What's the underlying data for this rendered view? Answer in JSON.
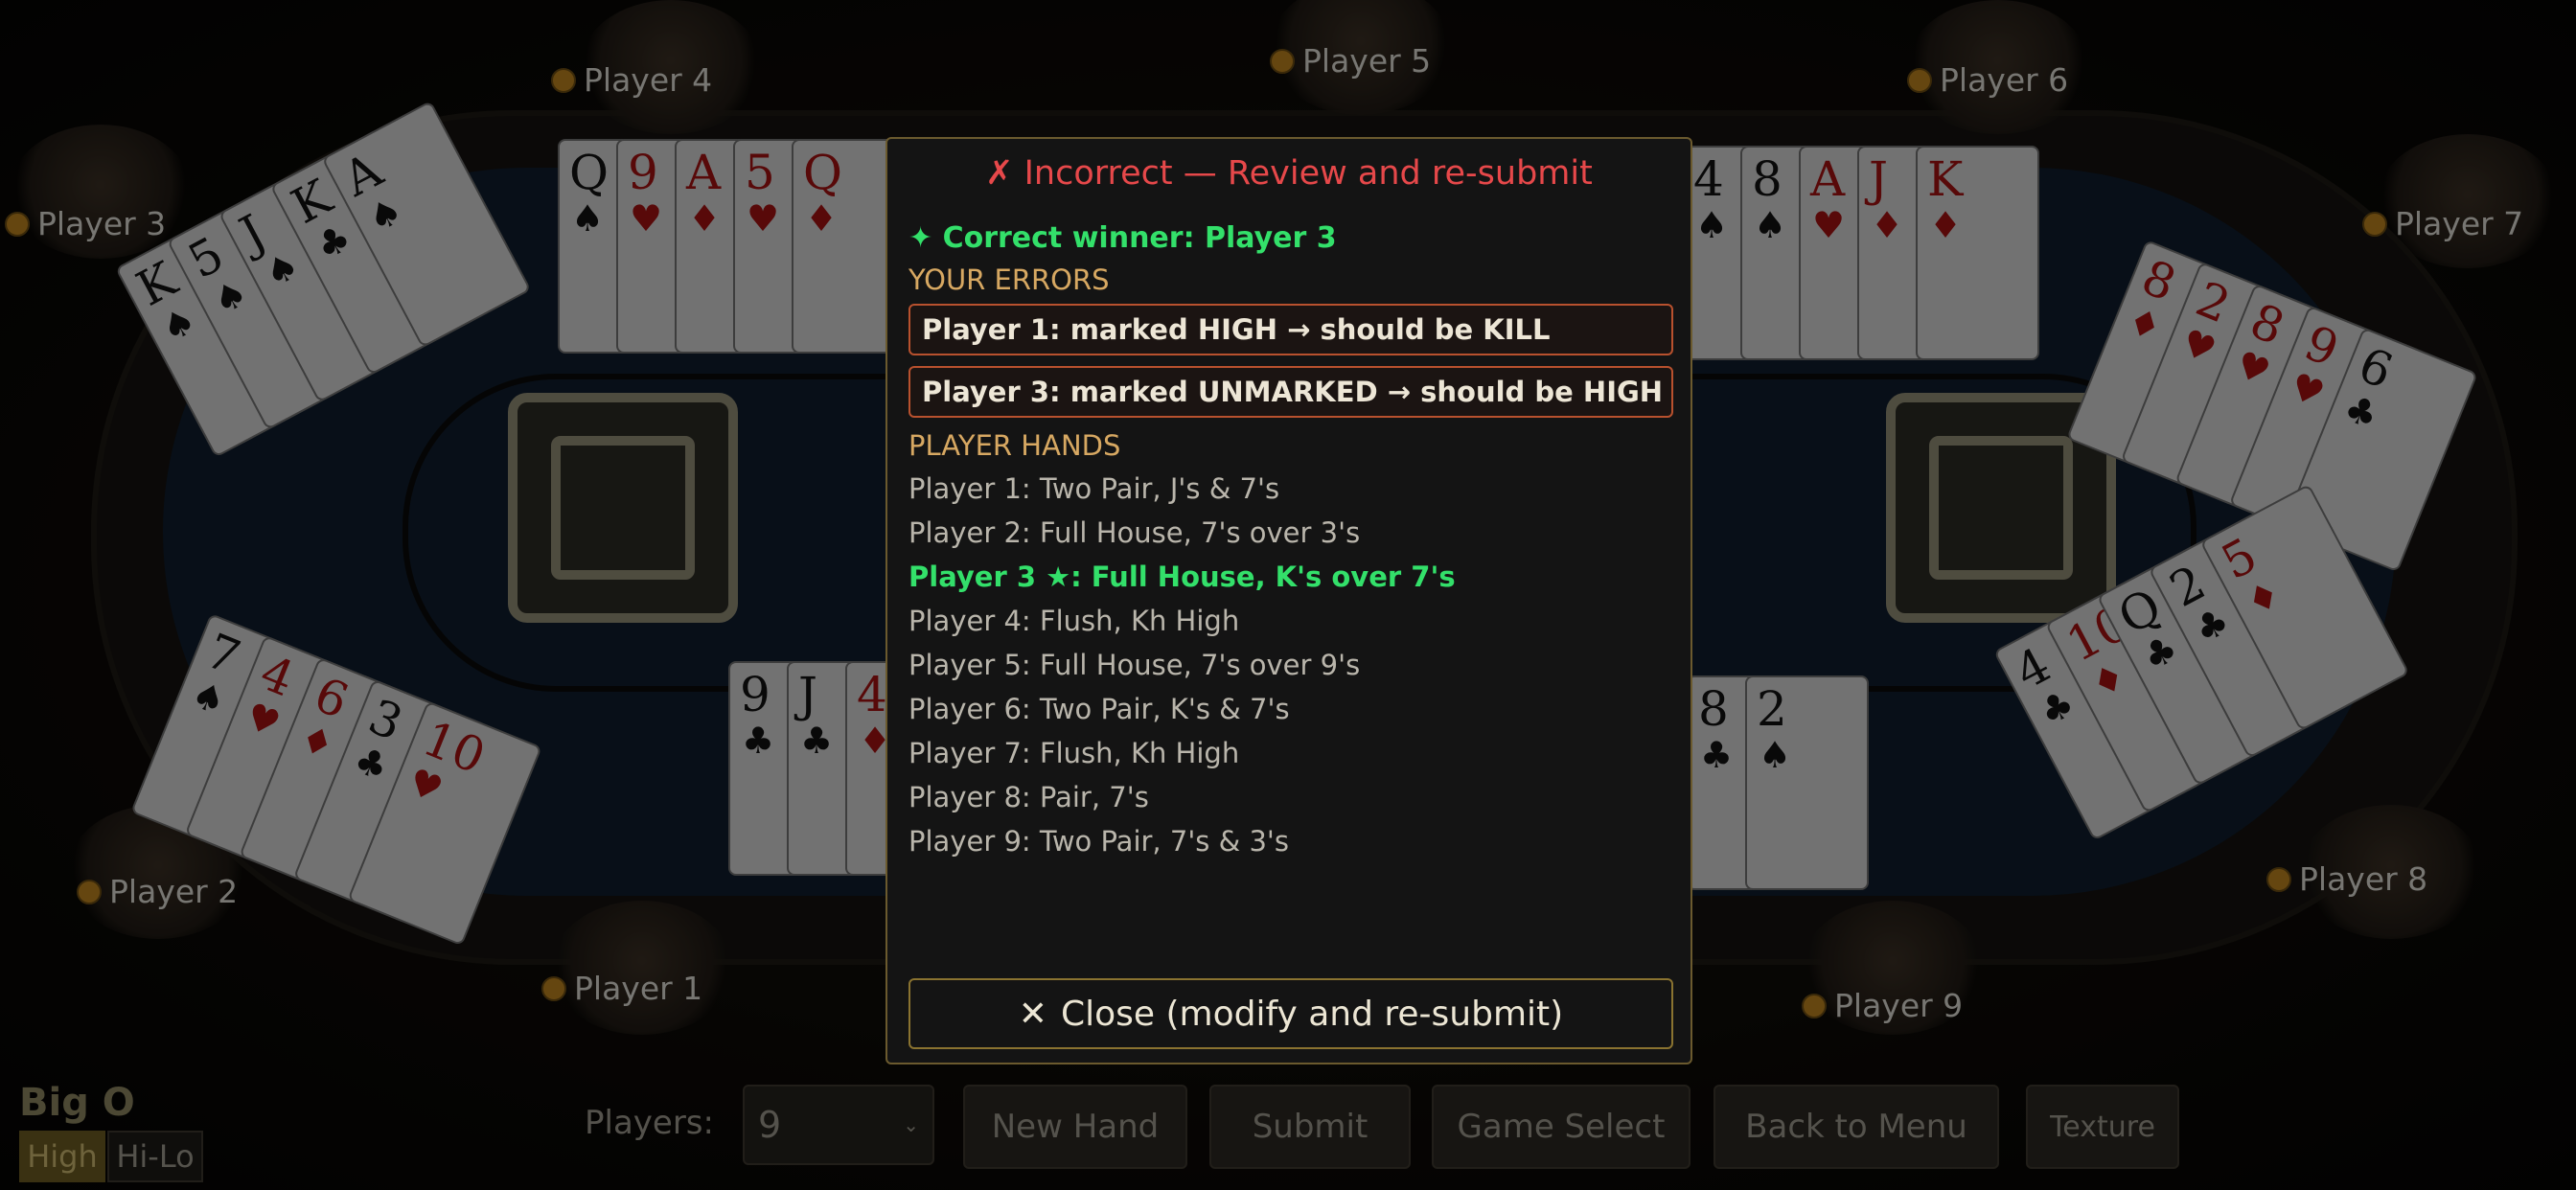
{
  "seats": [
    {
      "name": "Player 1"
    },
    {
      "name": "Player 2"
    },
    {
      "name": "Player 3"
    },
    {
      "name": "Player 4"
    },
    {
      "name": "Player 5"
    },
    {
      "name": "Player 6"
    },
    {
      "name": "Player 7"
    },
    {
      "name": "Player 8"
    },
    {
      "name": "Player 9"
    }
  ],
  "table_cards": {
    "p4": [
      {
        "rank": "Q",
        "suit": "♠",
        "color": "black"
      },
      {
        "rank": "9",
        "suit": "♥",
        "color": "red"
      },
      {
        "rank": "A",
        "suit": "♦",
        "color": "red"
      },
      {
        "rank": "5",
        "suit": "♥",
        "color": "red"
      },
      {
        "rank": "Q",
        "suit": "♦",
        "color": "red"
      }
    ],
    "p6": [
      {
        "rank": "4",
        "suit": "♠",
        "color": "black"
      },
      {
        "rank": "8",
        "suit": "♠",
        "color": "black"
      },
      {
        "rank": "A",
        "suit": "♥",
        "color": "red"
      },
      {
        "rank": "J",
        "suit": "♦",
        "color": "red"
      },
      {
        "rank": "K",
        "suit": "♦",
        "color": "red"
      }
    ],
    "p3": [
      {
        "rank": "K",
        "suit": "♠",
        "color": "black"
      },
      {
        "rank": "5",
        "suit": "♠",
        "color": "black"
      },
      {
        "rank": "J",
        "suit": "♠",
        "color": "black"
      },
      {
        "rank": "K",
        "suit": "♣",
        "color": "black"
      },
      {
        "rank": "A",
        "suit": "♠",
        "color": "black"
      }
    ],
    "p2": [
      {
        "rank": "7",
        "suit": "♠",
        "color": "black"
      },
      {
        "rank": "4",
        "suit": "♥",
        "color": "red"
      },
      {
        "rank": "6",
        "suit": "♦",
        "color": "red"
      },
      {
        "rank": "3",
        "suit": "♣",
        "color": "black"
      },
      {
        "rank": "10",
        "suit": "♥",
        "color": "red"
      }
    ],
    "p7": [
      {
        "rank": "8",
        "suit": "♦",
        "color": "red"
      },
      {
        "rank": "2",
        "suit": "♥",
        "color": "red"
      },
      {
        "rank": "8",
        "suit": "♥",
        "color": "red"
      },
      {
        "rank": "9",
        "suit": "♥",
        "color": "red"
      },
      {
        "rank": "6",
        "suit": "♣",
        "color": "black"
      }
    ],
    "p8": [
      {
        "rank": "4",
        "suit": "♣",
        "color": "black"
      },
      {
        "rank": "10",
        "suit": "♦",
        "color": "red"
      },
      {
        "rank": "Q",
        "suit": "♣",
        "color": "black"
      },
      {
        "rank": "2",
        "suit": "♣",
        "color": "black"
      },
      {
        "rank": "5",
        "suit": "♦",
        "color": "red"
      }
    ],
    "p1": [
      {
        "rank": "9",
        "suit": "♣",
        "color": "black"
      },
      {
        "rank": "J",
        "suit": "♣",
        "color": "black"
      },
      {
        "rank": "4",
        "suit": "♦",
        "color": "red"
      }
    ],
    "p9": [
      {
        "rank": "8",
        "suit": "♣",
        "color": "black"
      },
      {
        "rank": "2",
        "suit": "♠",
        "color": "black"
      }
    ]
  },
  "modal": {
    "title": "✗ Incorrect — Review and re-submit",
    "winner": "✦ Correct winner: Player 3",
    "errors_heading": "YOUR ERRORS",
    "errors": [
      "Player 1: marked HIGH → should be KILL",
      "Player 3: marked UNMARKED → should be HIGH"
    ],
    "hands_heading": "PLAYER HANDS",
    "hands": [
      "Player 1: Two Pair, J's & 7's",
      "Player 2: Full House, 7's over 3's",
      "Player 3  ★: Full House, K's over 7's",
      "Player 4: Flush, Kh High",
      "Player 5: Full House, 7's over 9's",
      "Player 6: Two Pair, K's & 7's",
      "Player 7: Flush, Kh High",
      "Player 8: Pair, 7's",
      "Player 9: Two Pair, 7's & 3's"
    ],
    "winner_index": 2,
    "close_label": "Close (modify and re-submit)"
  },
  "controls": {
    "game_title": "Big O",
    "mode_high": "High",
    "mode_hilo": "Hi-Lo",
    "players_label": "Players:",
    "players_value": "9",
    "new_hand": "New Hand",
    "submit": "Submit",
    "game_select": "Game Select",
    "back_to_menu": "Back to Menu",
    "texture": "Texture"
  },
  "colors": {
    "error_red": "#e6484a",
    "winner_green": "#33e06a",
    "section_gold": "#d7a862",
    "card_red": "#a11212"
  }
}
